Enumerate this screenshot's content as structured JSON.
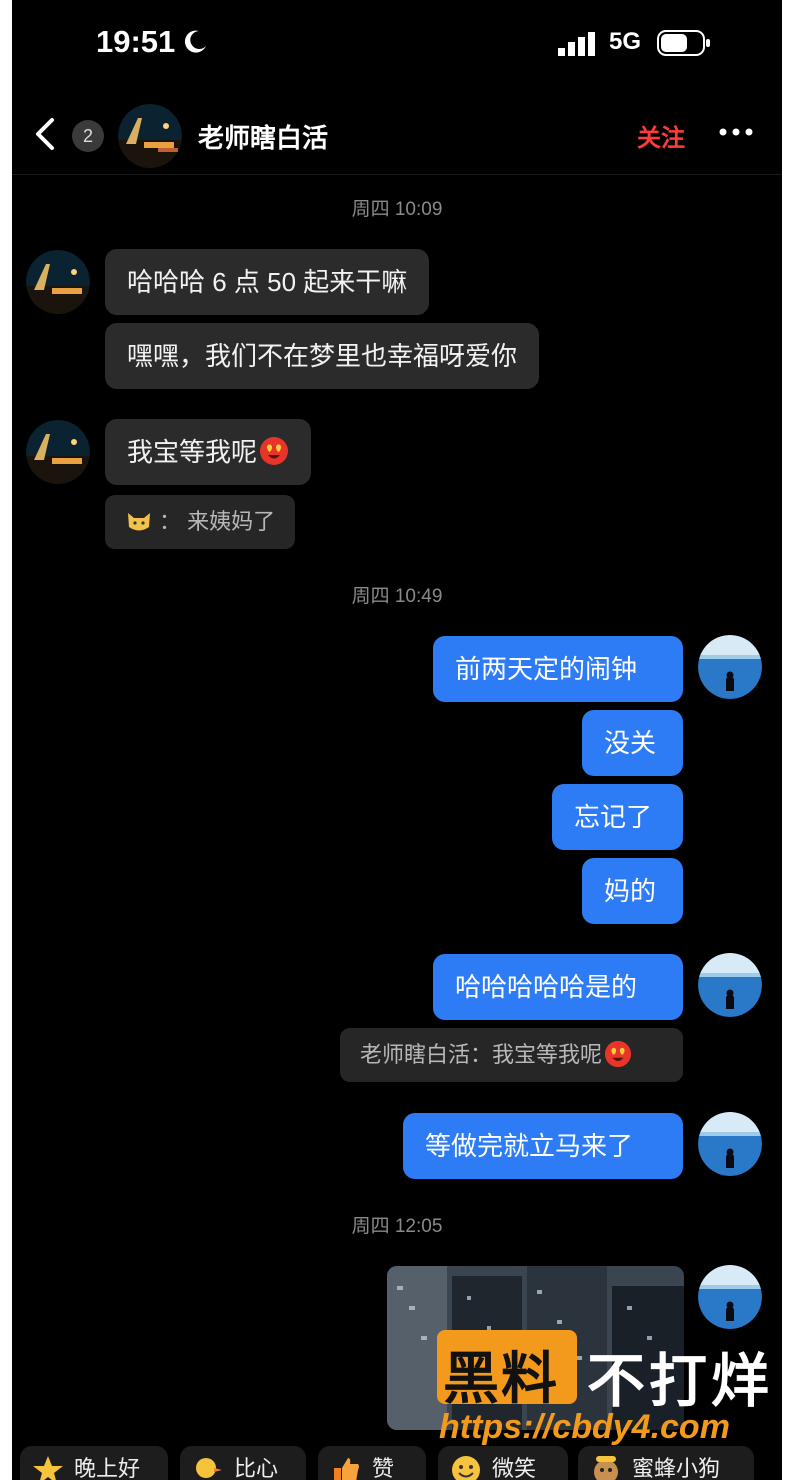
{
  "status_bar": {
    "time": "19:51",
    "network": "5G"
  },
  "header": {
    "back_icon": "chevron-left-icon",
    "unread_count": "2",
    "name": "老师瞎白活",
    "follow_label": "关注",
    "more_icon": "more-dots-icon"
  },
  "messages": {
    "ts1": "周四 10:09",
    "m1": "哈哈哈 6 点 50 起来干嘛",
    "m2": "嘿嘿，我们不在梦里也幸福呀爱你",
    "m3": "我宝等我呢",
    "m4_reply": "来姨妈了",
    "ts2": "周四 10:49",
    "o1": "前两天定的闹钟",
    "o2": "没关",
    "o3": "忘记了",
    "o4": "妈的",
    "o5": "哈哈哈哈哈是的",
    "quote": "老师瞎白活：我宝等我呢",
    "o6": "等做完就立马来了",
    "ts3": "周四 12:05"
  },
  "quick_replies": [
    {
      "label": "晚上好",
      "icon": "star-face-icon"
    },
    {
      "label": "比心",
      "icon": "duck-heart-icon"
    },
    {
      "label": "赞",
      "icon": "thumbs-up-icon"
    },
    {
      "label": "微笑",
      "icon": "smile-face-icon"
    },
    {
      "label": "蜜蜂小狗",
      "icon": "bee-dog-icon"
    }
  ],
  "watermark": {
    "part1": "黑料",
    "part2": "不打烊",
    "url": "https://cbdy4.com"
  },
  "colors": {
    "background": "#000000",
    "outgoing_bubble": "#2d7cf6",
    "incoming_bubble": "#2b2b2b",
    "follow": "#ff3b3b",
    "watermark_orange": "#f39a1c"
  }
}
